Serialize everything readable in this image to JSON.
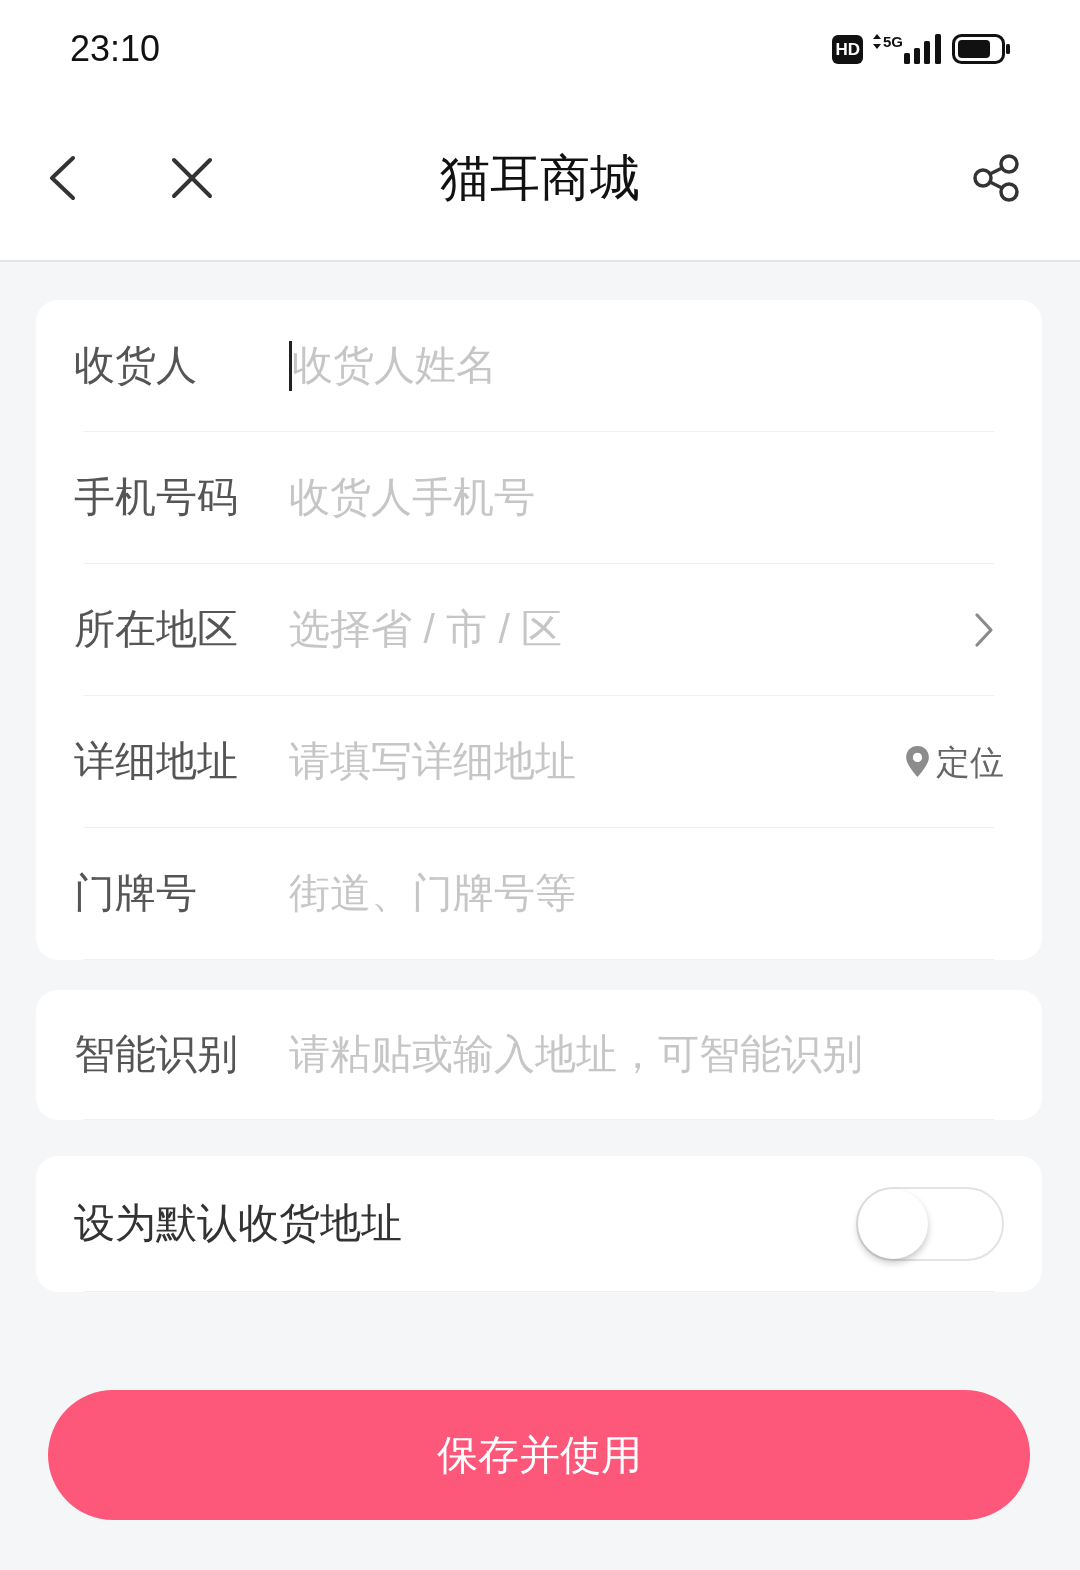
{
  "status_bar": {
    "time": "23:10",
    "hd": "HD",
    "network": "5G"
  },
  "header": {
    "title": "猫耳商城"
  },
  "address_form": {
    "fields": [
      {
        "kind": "text",
        "label": "收货人",
        "placeholder": "收货人姓名",
        "focused": true
      },
      {
        "kind": "text",
        "label": "手机号码",
        "placeholder": "收货人手机号",
        "focused": false
      },
      {
        "kind": "select",
        "label": "所在地区",
        "placeholder": "选择省 / 市 / 区",
        "focused": false
      },
      {
        "kind": "locate",
        "label": "详细地址",
        "placeholder": "请填写详细地址",
        "focused": false,
        "action": "定位"
      },
      {
        "kind": "text",
        "label": "门牌号",
        "placeholder": "街道、门牌号等",
        "focused": false
      }
    ]
  },
  "smart_parse": {
    "label": "智能识别",
    "placeholder": "请粘贴或输入地址，可智能识别"
  },
  "default_address": {
    "label": "设为默认收货地址",
    "on": false
  },
  "save_button": {
    "label": "保存并使用"
  }
}
